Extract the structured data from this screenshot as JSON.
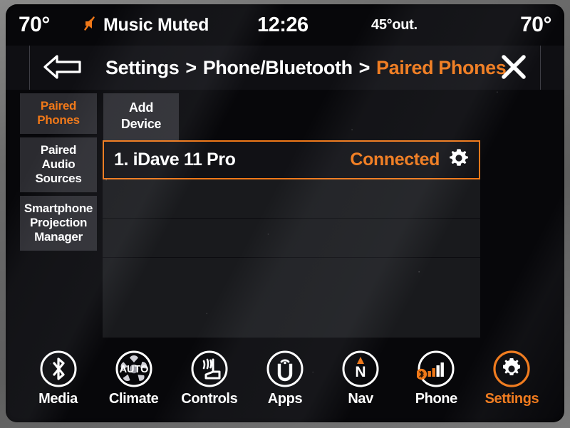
{
  "colors": {
    "accent": "#f07818",
    "text": "#ffffff",
    "screen_bg": "#07070a",
    "panel": "#3a3a40"
  },
  "status_bar": {
    "temp_left": "70°",
    "mute_icon": "muted-speaker-icon",
    "mute_label": "Music Muted",
    "clock": "12:26",
    "outside_temp": "45°out.",
    "temp_right": "70°"
  },
  "header": {
    "back_icon": "back-arrow-icon",
    "close_icon": "close-icon",
    "breadcrumb": {
      "segments": [
        "Settings",
        "Phone/Bluetooth",
        "Paired Phones"
      ],
      "separator": ">",
      "active_index": 2
    }
  },
  "sidebar": {
    "items": [
      {
        "lines": [
          "Paired",
          "Phones"
        ],
        "active": true
      },
      {
        "lines": [
          "Paired",
          "Audio",
          "Sources"
        ],
        "active": false
      },
      {
        "lines": [
          "Smartphone",
          "Projection",
          "Manager"
        ],
        "active": false
      }
    ]
  },
  "main": {
    "add_device": {
      "lines": [
        "Add",
        "Device"
      ]
    },
    "device_rows": [
      {
        "name": "1. iDave 11 Pro",
        "status": "Connected",
        "settings_icon": "gear-icon",
        "selected": true
      },
      {
        "name": "",
        "status": "",
        "selected": false
      },
      {
        "name": "",
        "status": "",
        "selected": false
      },
      {
        "name": "",
        "status": "",
        "selected": false
      }
    ]
  },
  "bottom_nav": {
    "items": [
      {
        "label": "Media",
        "icon": "bluetooth-icon",
        "active": false
      },
      {
        "label": "Climate",
        "icon": "auto-fan-icon",
        "active": false
      },
      {
        "label": "Controls",
        "icon": "seat-icon",
        "active": false
      },
      {
        "label": "Apps",
        "icon": "uconnect-icon",
        "active": false
      },
      {
        "label": "Nav",
        "icon": "compass-north-icon",
        "active": false
      },
      {
        "label": "Phone",
        "icon": "signal-bars-icon",
        "active": false,
        "badge": "bluetooth-badge-icon"
      },
      {
        "label": "Settings",
        "icon": "gear-icon",
        "active": true
      }
    ]
  }
}
